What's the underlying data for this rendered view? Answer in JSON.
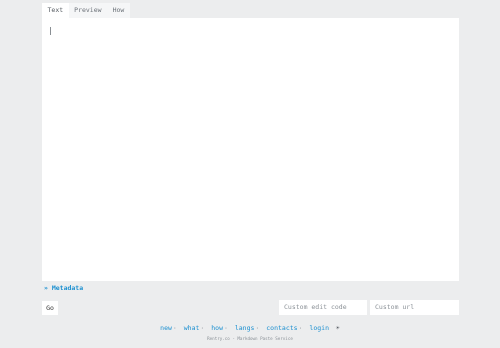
{
  "tabs": [
    {
      "label": "Text"
    },
    {
      "label": "Preview"
    },
    {
      "label": "How"
    }
  ],
  "metadata_toggle": "» Metadata",
  "go_button": "Go",
  "edit_code": {
    "placeholder": "Custom edit code"
  },
  "custom_url": {
    "placeholder": "Custom url"
  },
  "footer": {
    "links": [
      {
        "label": "new"
      },
      {
        "label": "what"
      },
      {
        "label": "how"
      },
      {
        "label": "langs"
      },
      {
        "label": "contacts"
      },
      {
        "label": "login"
      }
    ],
    "separator": "·",
    "theme_icon": "☀",
    "tagline": "Rentry.co - Markdown Paste Service"
  }
}
